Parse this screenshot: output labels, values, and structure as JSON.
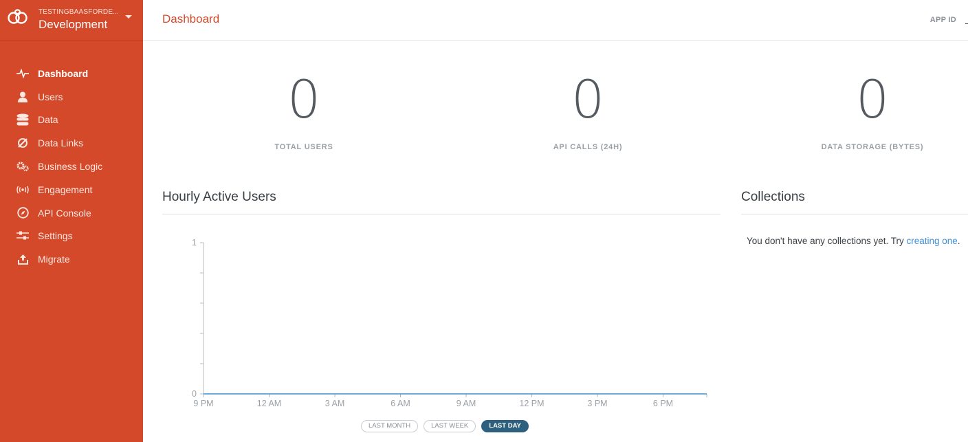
{
  "app": {
    "org": "TESTINGBAASFORDE...",
    "environment": "Development"
  },
  "sidebar": {
    "items": [
      {
        "label": "Dashboard",
        "icon": "pulse-icon",
        "active": true
      },
      {
        "label": "Users",
        "icon": "user-icon"
      },
      {
        "label": "Data",
        "icon": "database-icon"
      },
      {
        "label": "Data Links",
        "icon": "link-icon"
      },
      {
        "label": "Business Logic",
        "icon": "gears-icon"
      },
      {
        "label": "Engagement",
        "icon": "broadcast-icon"
      },
      {
        "label": "API Console",
        "icon": "compass-icon"
      },
      {
        "label": "Settings",
        "icon": "sliders-icon"
      },
      {
        "label": "Migrate",
        "icon": "upload-icon"
      }
    ]
  },
  "header": {
    "title": "Dashboard",
    "app_id_label": "APP ID"
  },
  "stats": [
    {
      "value": "0",
      "label": "TOTAL USERS"
    },
    {
      "value": "0",
      "label": "API CALLS (24H)"
    },
    {
      "value": "0",
      "label": "DATA STORAGE (BYTES)"
    }
  ],
  "hourly": {
    "title": "Hourly Active Users",
    "range_buttons": [
      "LAST MONTH",
      "LAST WEEK",
      "LAST DAY"
    ],
    "active_range": "LAST DAY"
  },
  "chart_data": {
    "type": "line",
    "title": "",
    "xlabel": "",
    "ylabel": "",
    "x": [
      "9 PM",
      "12 AM",
      "3 AM",
      "6 AM",
      "9 AM",
      "12 PM",
      "3 PM",
      "6 PM"
    ],
    "series": [
      {
        "values": [
          0,
          0,
          0,
          0,
          0,
          0,
          0,
          0
        ]
      }
    ],
    "ylim": [
      0,
      1
    ],
    "yticks": [
      "0",
      "1"
    ],
    "line_color": "#3b8fd6"
  },
  "collections": {
    "title": "Collections",
    "empty_text": "You don't have any collections yet. Try ",
    "link_text": "creating one",
    "trailing": "."
  },
  "colors": {
    "brand": "#d4492a",
    "active_range": "#2d5f7f",
    "link": "#3b8fd6"
  }
}
